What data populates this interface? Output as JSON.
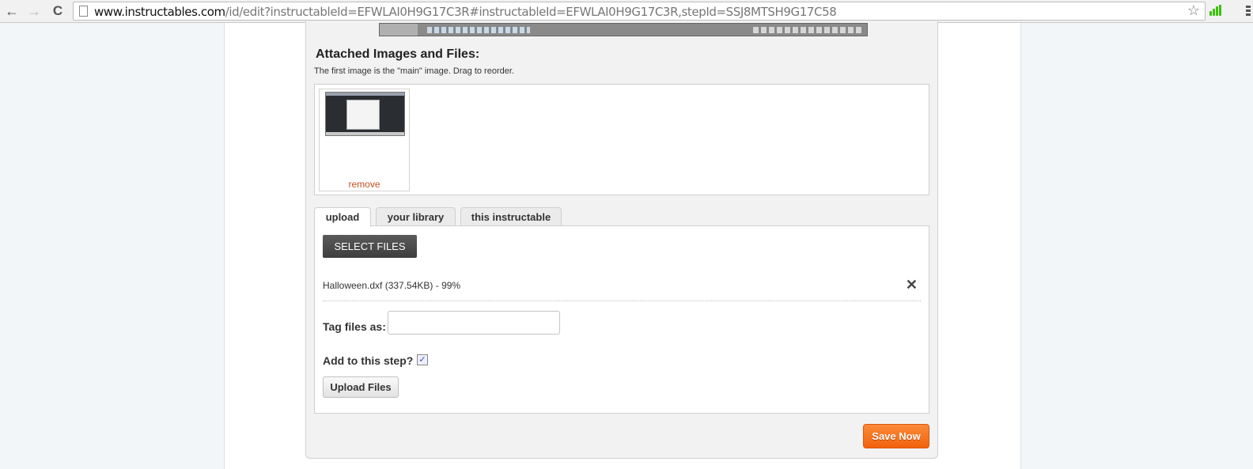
{
  "browser": {
    "url_host": "www.instructables.com",
    "url_path": "/id/edit?instructableId=EFWLAI0H9G17C3R#instructableId=EFWLAI0H9G17C3R,stepId=SSJ8MTSH9G17C58",
    "back_icon": "←",
    "forward_icon": "→",
    "reload_icon": "C",
    "star_icon": "☆"
  },
  "attachments": {
    "title": "Attached Images and Files:",
    "subtitle": "The first image is the \"main\" image. Drag to reorder.",
    "images": [
      {
        "remove_label": "remove"
      }
    ]
  },
  "tabs": [
    {
      "label": "upload",
      "active": true
    },
    {
      "label": "your library",
      "active": false
    },
    {
      "label": "this instructable",
      "active": false
    }
  ],
  "upload": {
    "select_files_label": "SELECT FILES",
    "files": [
      {
        "name": "Halloween.dxf (337.54KB) - 99%",
        "progress_percent": 99
      }
    ],
    "close_icon": "✕",
    "tag_label": "Tag files as:",
    "tag_value": "",
    "add_to_step_label": "Add to this step?",
    "add_to_step_checked": true,
    "checkmark": "✓",
    "upload_button_label": "Upload Files"
  },
  "save_button_label": "Save Now",
  "colors": {
    "save_orange": "#f1620c",
    "remove_link": "#c8501c"
  }
}
